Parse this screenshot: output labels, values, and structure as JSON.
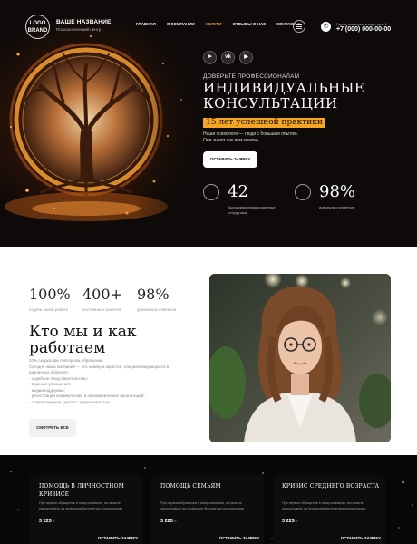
{
  "header": {
    "logo_line1": "LOGO",
    "logo_line2": "BRAND",
    "brand_name": "ВАШЕ НАЗВАНИЕ",
    "brand_sub": "Психологический центр",
    "nav": [
      "ГЛАВНАЯ",
      "О КОМПАНИИ",
      "УСЛУГИ",
      "ОТЗЫВЫ О НАС",
      "КОНТАКТЫ"
    ],
    "active_nav_index": 2,
    "address": "Город, название улицы, дом 1",
    "phone": "+7 (000) 000-00-00"
  },
  "hero": {
    "socials": [
      {
        "icon": "telegram-icon",
        "glyph": "➤"
      },
      {
        "icon": "vk-icon",
        "glyph": "vk"
      },
      {
        "icon": "youtube-icon",
        "glyph": "▶"
      }
    ],
    "pretitle": "ДОВЕРЬТЕ ПРОФЕССИОНАЛАМ",
    "title_line1": "ИНДИВИДУАЛЬНЫЕ",
    "title_line2": "КОНСУЛЬТАЦИИ",
    "highlight": "15 лет успешной практики",
    "desc_line1": "Наши психологи — люди с большим опытом.",
    "desc_line2": "Они знают как вам помочь",
    "cta": "ОСТАВИТЬ ЗАЯВКУ",
    "stats": [
      {
        "num": "42",
        "cap1": "Высококвалифицированных",
        "cap2": "сотрудника",
        "icon": "team-icon"
      },
      {
        "num": "98%",
        "cap1": "довольных клиентов",
        "cap2": "",
        "icon": "badge-icon"
      }
    ],
    "accent": "#f5a524"
  },
  "about": {
    "stats": [
      {
        "num": "100%",
        "cap": "отдачи своей работе"
      },
      {
        "num": "400+",
        "cap": "постоянных клиента"
      },
      {
        "num": "98%",
        "cap": "довольных клиентов"
      }
    ],
    "title_line1": "Кто мы и как",
    "title_line2": "работаем",
    "text": [
      "20% скидка при повторном обращении",
      "Сегодня наша компания — это команда юристов, специализирующихся в",
      "различных областях:",
      "- судебное представительство;",
      "- ведение упрощения;",
      "- медиаподдержке;",
      "- регистрация коммерческих и некоммерческих организаций;",
      "- сопровождение сделок с недвижимостью"
    ],
    "button": "СМОТРЕТЬ ВСЕ"
  },
  "services": [
    {
      "title_line1": "ПОМОЩЬ В ЛИЧНОСТНОМ",
      "title_line2": "КРИЗИСЕ",
      "desc1": "При первом обращении в нашу компанию, вы можете",
      "desc2": "рассчитывать на первичную бесплатную консультацию",
      "price": "3 225",
      "currency": "₽",
      "button": "ОСТАВИТЬ ЗАЯВКУ"
    },
    {
      "title_line1": "ПОМОЩЬ СЕМЬЯМ",
      "title_line2": "",
      "desc1": "При первом обращении в нашу компанию, вы можете",
      "desc2": "рассчитывать на первичную бесплатную консультацию",
      "price": "3 225",
      "currency": "₽",
      "button": "ОСТАВИТЬ ЗАЯВКУ"
    },
    {
      "title_line1": "КРИЗИС СРЕДНЕГО ВОЗРАСТА",
      "title_line2": "",
      "desc1": "При первом обращении в нашу компанию, вы можете",
      "desc2": "рассчитывать на первичную бесплатную консультацию",
      "price": "3 225",
      "currency": "₽",
      "button": "ОСТАВИТЬ ЗАЯВКУ"
    }
  ]
}
